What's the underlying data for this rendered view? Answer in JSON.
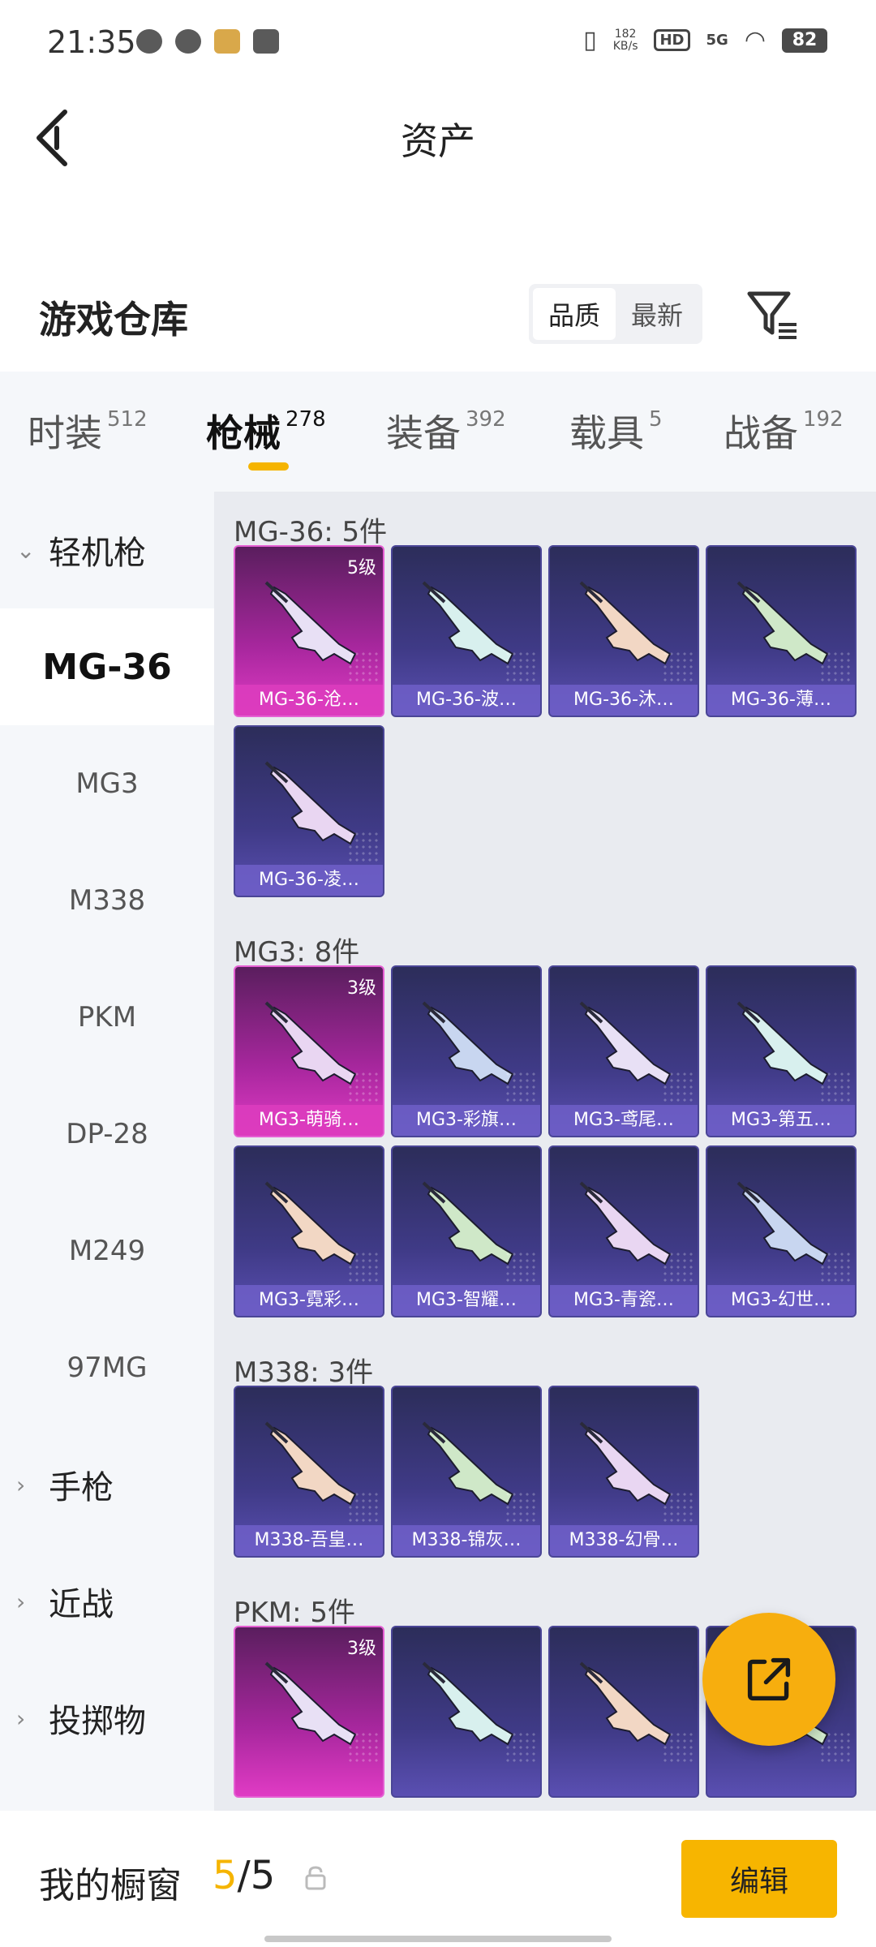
{
  "status_bar": {
    "time": "21:35",
    "net_speed_value": "182",
    "net_speed_unit": "KB/s",
    "hd": "HD",
    "signal": "5G",
    "battery": "82"
  },
  "header": {
    "title": "资产"
  },
  "warehouse": {
    "title": "游戏仓库",
    "sort_options": [
      "品质",
      "最新"
    ],
    "active_sort": "品质"
  },
  "categories": [
    {
      "name": "时装",
      "count": "512"
    },
    {
      "name": "枪械",
      "count": "278"
    },
    {
      "name": "装备",
      "count": "392"
    },
    {
      "name": "载具",
      "count": "5"
    },
    {
      "name": "战备",
      "count": "192"
    }
  ],
  "active_category": "枪械",
  "sidebar": {
    "groups": [
      {
        "label": "轻机枪",
        "expanded": true
      },
      {
        "label": "手枪",
        "expanded": false
      },
      {
        "label": "近战",
        "expanded": false
      },
      {
        "label": "投掷物",
        "expanded": false
      }
    ],
    "items": [
      "MG-36",
      "MG3",
      "M338",
      "PKM",
      "DP-28",
      "M249",
      "97MG"
    ],
    "active_item": "MG-36"
  },
  "sections": [
    {
      "title": "MG-36: 5件",
      "cards": [
        {
          "label": "MG-36-沧…",
          "level": "5级",
          "rarity": "pink"
        },
        {
          "label": "MG-36-波…",
          "level": "",
          "rarity": "purple"
        },
        {
          "label": "MG-36-沐…",
          "level": "",
          "rarity": "purple"
        },
        {
          "label": "MG-36-薄…",
          "level": "",
          "rarity": "purple"
        },
        {
          "label": "MG-36-凌…",
          "level": "",
          "rarity": "purple"
        }
      ]
    },
    {
      "title": "MG3: 8件",
      "cards": [
        {
          "label": "MG3-萌骑…",
          "level": "3级",
          "rarity": "pink"
        },
        {
          "label": "MG3-彩旗…",
          "level": "",
          "rarity": "purple"
        },
        {
          "label": "MG3-鸢尾…",
          "level": "",
          "rarity": "purple"
        },
        {
          "label": "MG3-第五…",
          "level": "",
          "rarity": "purple"
        },
        {
          "label": "MG3-霓彩…",
          "level": "",
          "rarity": "purple"
        },
        {
          "label": "MG3-智耀…",
          "level": "",
          "rarity": "purple"
        },
        {
          "label": "MG3-青瓷…",
          "level": "",
          "rarity": "purple"
        },
        {
          "label": "MG3-幻世…",
          "level": "",
          "rarity": "purple"
        }
      ]
    },
    {
      "title": "M338: 3件",
      "cards": [
        {
          "label": "M338-吾皇…",
          "level": "",
          "rarity": "purple"
        },
        {
          "label": "M338-锦灰…",
          "level": "",
          "rarity": "purple"
        },
        {
          "label": "M338-幻骨…",
          "level": "",
          "rarity": "purple"
        }
      ]
    },
    {
      "title": "PKM: 5件",
      "cards": [
        {
          "label": "",
          "level": "3级",
          "rarity": "pink"
        },
        {
          "label": "",
          "level": "",
          "rarity": "purple"
        },
        {
          "label": "",
          "level": "",
          "rarity": "purple"
        },
        {
          "label": "",
          "level": "",
          "rarity": "purple"
        }
      ]
    }
  ],
  "showcase": {
    "label": "我的橱窗",
    "current": "5",
    "separator": "/",
    "total": "5"
  },
  "edit_button": "编辑",
  "colors": {
    "accent": "#f7b500",
    "card_pink": "#e03bc4",
    "card_purple": "#3f3a86"
  },
  "icons": [
    "back-arrow-icon",
    "filter-icon",
    "share-export-icon",
    "lock-icon",
    "chevron-down-icon",
    "chevron-right-icon"
  ]
}
